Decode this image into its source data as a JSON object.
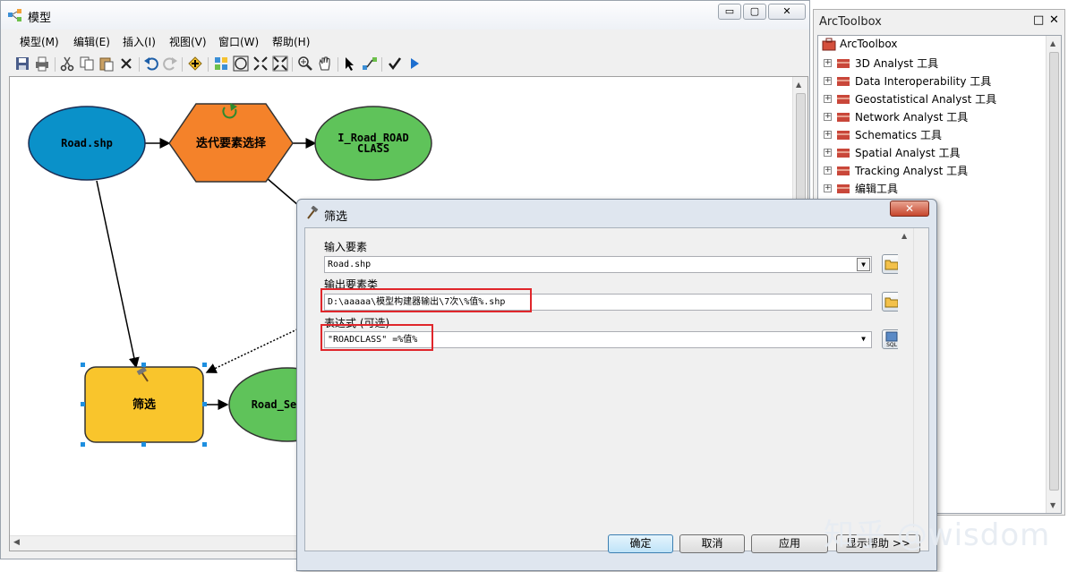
{
  "model_window": {
    "title": "模型",
    "controls": {
      "minimize": "▭",
      "maximize": "▢",
      "close": "✕"
    },
    "menu": [
      "模型(M)",
      "编辑(E)",
      "插入(I)",
      "视图(V)",
      "窗口(W)",
      "帮助(H)"
    ],
    "toolbar_icons": [
      "save-icon",
      "print-icon",
      "cut-icon",
      "copy-icon",
      "paste-icon",
      "delete-icon",
      "undo-icon",
      "redo-icon",
      "add-data-icon",
      "auto-layout-icon",
      "full-extent-icon",
      "fixed-zoom-in-icon",
      "fixed-zoom-out-icon",
      "zoom-in-icon",
      "pan-icon",
      "select-icon",
      "connect-icon",
      "validate-icon",
      "run-icon"
    ],
    "nodes": {
      "road_shp": "Road.shp",
      "iterate_line1": "迭代要素选择",
      "output_line1": "I_Road_ROAD",
      "output_line2": "CLASS",
      "filter": "筛选",
      "road_select": "Road_Se"
    }
  },
  "arctoolbox": {
    "title": "ArcToolbox",
    "controls": {
      "pin": "□",
      "close": "✕"
    },
    "root": "ArcToolbox",
    "items": [
      "3D Analyst 工具",
      "Data Interoperability 工具",
      "Geostatistical Analyst 工具",
      "Network Analyst 工具",
      "Schematics 工具",
      "Spatial Analyst 工具",
      "Tracking Analyst 工具",
      "编辑工具"
    ]
  },
  "filter_dialog": {
    "title": "筛选",
    "close_label": "✕",
    "fields": {
      "input_label": "输入要素",
      "input_value": "Road.shp",
      "output_label": "输出要素类",
      "output_value": "D:\\aaaaa\\模型构建器输出\\7次\\%值%.shp",
      "expression_label": "表达式 (可选)",
      "expression_value": "\"ROADCLASS\" =%值%"
    },
    "sql_label": "SQL",
    "buttons": {
      "ok": "确定",
      "cancel": "取消",
      "apply": "应用",
      "help": "显示帮助 >>"
    }
  },
  "watermark": "知乎 @wisdom",
  "colors": {
    "road_shp_fill": "#0a91c9",
    "iterator_fill": "#f4822a",
    "output_fill": "#5fc35a",
    "tool_fill": "#f9c52c",
    "highlight": "#e0262b"
  }
}
